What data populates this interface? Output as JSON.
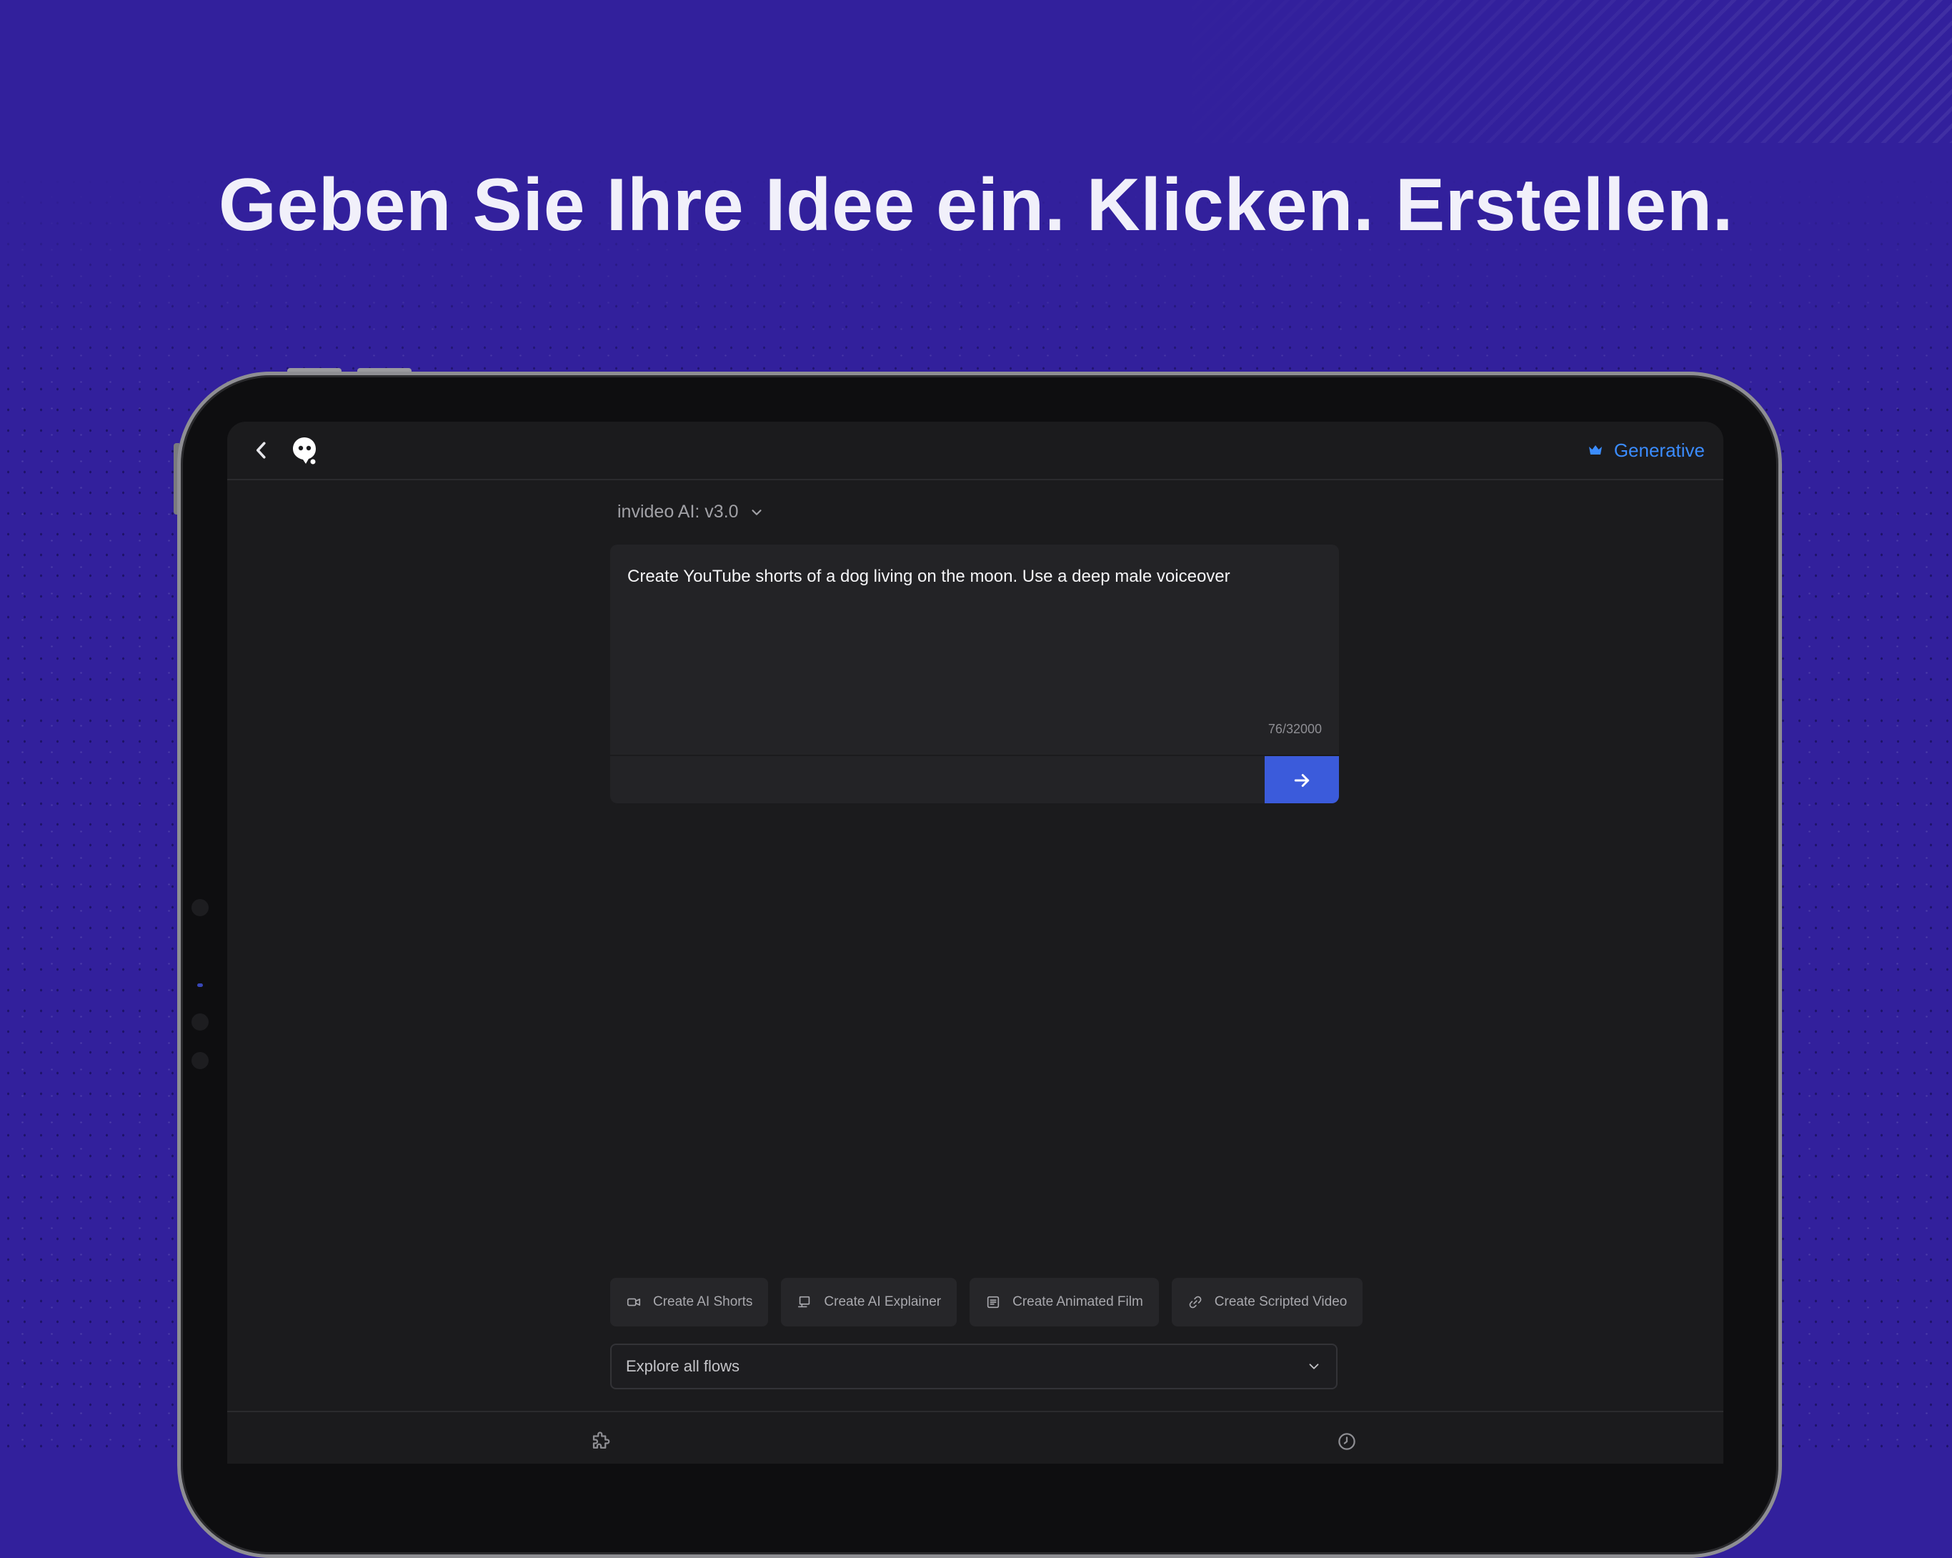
{
  "headline": "Geben Sie Ihre Idee ein. Klicken. Erstellen.",
  "colors": {
    "background": "#32209c",
    "accent": "#3b5bdb",
    "plan_text": "#3b8cff",
    "screen_bg": "#1b1b1d"
  },
  "app": {
    "header": {
      "back_icon": "chevron-left-icon",
      "logo_icon": "ghost-logo-icon",
      "plan_icon": "crown-icon",
      "plan_label": "Generative"
    },
    "model_select": {
      "label": "invideo AI: v3.0",
      "icon": "chevron-down-icon"
    },
    "prompt": {
      "text": "Create YouTube shorts of a dog living on the moon. Use a deep male voiceover",
      "counter": "76/32000",
      "submit_icon": "arrow-right-icon"
    },
    "workflows": [
      {
        "label": "Create AI Shorts",
        "icon": "video-camera-icon"
      },
      {
        "label": "Create AI Explainer",
        "icon": "presentation-icon"
      },
      {
        "label": "Create Animated Film",
        "icon": "document-icon"
      },
      {
        "label": "Create Scripted Video",
        "icon": "link-icon"
      }
    ],
    "flows_select": {
      "label": "Explore all flows",
      "icon": "chevron-down-icon"
    },
    "bottom_bar": {
      "left_icon": "puzzle-icon",
      "right_icon": "history-clock-icon"
    }
  }
}
